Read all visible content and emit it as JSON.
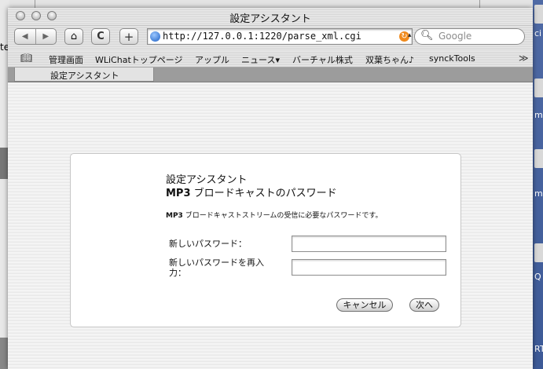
{
  "window": {
    "title": "設定アシスタント"
  },
  "toolbar": {
    "back_glyph": "◀",
    "forward_glyph": "▶",
    "home_glyph": "⌂",
    "reload_glyph": "C",
    "add_glyph": "+",
    "url": "http://127.0.0.1:1220/parse_xml.cgi",
    "search_placeholder": "Google"
  },
  "bookmarks": {
    "items": [
      "管理画面",
      "WLiChatトップページ",
      "アップル",
      "ニュース▾",
      "バーチャル株式",
      "双葉ちゃん♪",
      "synckTools"
    ],
    "more_glyph": "≫"
  },
  "tabs": [
    {
      "label": "設定アシスタント"
    }
  ],
  "dialog": {
    "title": "設定アシスタント",
    "subtitle_bold": "MP3",
    "subtitle_rest": " ブロードキャストのパスワード",
    "desc_bold": "MP3",
    "desc_rest": " ブロードキャストストリームの受信に必要なパスワードです。",
    "fields": [
      {
        "label": "新しいパスワード：",
        "value": ""
      },
      {
        "label": "新しいパスワードを再入力：",
        "value": ""
      }
    ],
    "cancel_label": "キャンセル",
    "next_label": "次へ"
  },
  "desktop": {
    "left_text": "te",
    "right_labels": [
      "ci",
      "m",
      "me",
      "Q",
      "RTS"
    ]
  },
  "colors": {
    "desktop_blue": "#4f6aa5",
    "accent_orange": "#f08a1c"
  }
}
